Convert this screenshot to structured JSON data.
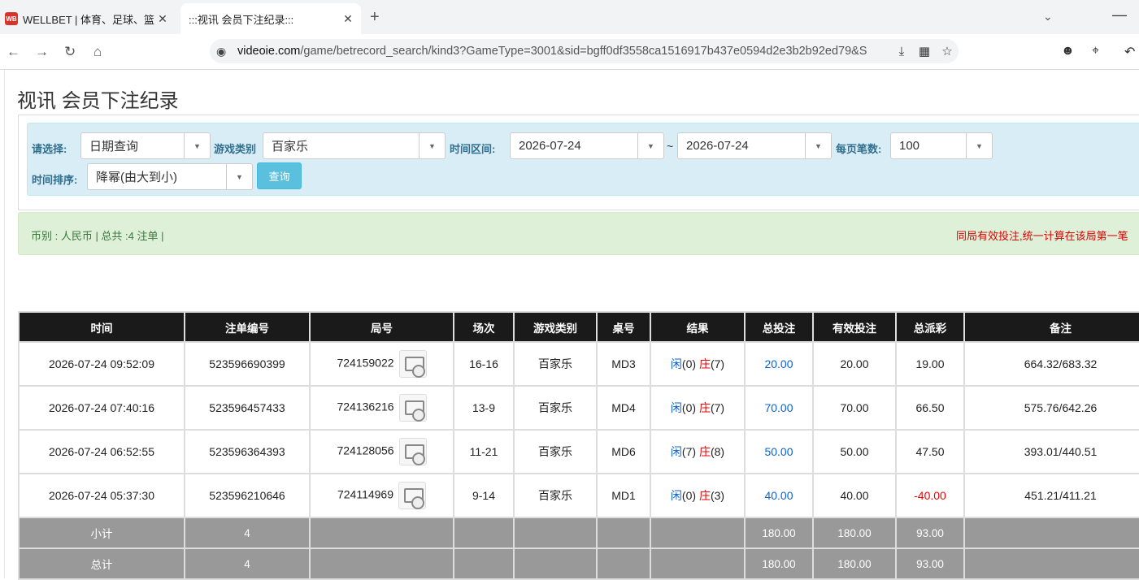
{
  "browser": {
    "tabs": [
      {
        "favicon": "WB",
        "title": "WELLBET | 体育、足球、篮球、",
        "close": "✕"
      },
      {
        "title": ":::视讯 会员下注纪录:::",
        "close": "✕"
      }
    ],
    "new_tab": "+",
    "url_host": "videoie.com",
    "url_path": "/game/betrecord_search/kind3?GameType=3001&sid=bgff0df3558ca1516917b437e0594d2e3b2b92ed79&S"
  },
  "page": {
    "title": "视讯 会员下注纪录",
    "filter": {
      "select_label": "请选择:",
      "select_value": "日期查询",
      "game_label": "游戏类别",
      "game_value": "百家乐",
      "time_label": "时间区间:",
      "date_from": "2026-07-24",
      "tilde": "~",
      "date_to": "2026-07-24",
      "per_page_label": "每页笔数",
      "per_page_value": "100",
      "sort_label": "时间排序:",
      "sort_value": "降幂(由大到小)",
      "query_button": "查询"
    },
    "info": {
      "left": "币别 : 人民币 | 总共 :4 注单 |",
      "right": "同局有效投注,统一计算在该局第一笔"
    },
    "table": {
      "headers": [
        "时间",
        "注单编号",
        "局号",
        "场次",
        "游戏类别",
        "桌号",
        "结果",
        "总投注",
        "有效投注",
        "总派彩",
        "备注"
      ],
      "rows": [
        {
          "time": "2026-07-24 09:52:09",
          "order": "523596690399",
          "round": "724159022",
          "session": "16-16",
          "game": "百家乐",
          "table": "MD3",
          "player": "闲",
          "player_v": "(0)",
          "banker": "庄",
          "banker_v": "(7)",
          "bet": "20.00",
          "valid": "20.00",
          "payout": "19.00",
          "note": "664.32/683.32"
        },
        {
          "time": "2026-07-24 07:40:16",
          "order": "523596457433",
          "round": "724136216",
          "session": "13-9",
          "game": "百家乐",
          "table": "MD4",
          "player": "闲",
          "player_v": "(0)",
          "banker": "庄",
          "banker_v": "(7)",
          "bet": "70.00",
          "valid": "70.00",
          "payout": "66.50",
          "note": "575.76/642.26"
        },
        {
          "time": "2026-07-24 06:52:55",
          "order": "523596364393",
          "round": "724128056",
          "session": "11-21",
          "game": "百家乐",
          "table": "MD6",
          "player": "闲",
          "player_v": "(7)",
          "banker": "庄",
          "banker_v": "(8)",
          "bet": "50.00",
          "valid": "50.00",
          "payout": "47.50",
          "note": "393.01/440.51"
        },
        {
          "time": "2026-07-24 05:37:30",
          "order": "523596210646",
          "round": "724114969",
          "session": "9-14",
          "game": "百家乐",
          "table": "MD1",
          "player": "闲",
          "player_v": "(0)",
          "banker": "庄",
          "banker_v": "(3)",
          "bet": "40.00",
          "valid": "40.00",
          "payout": "-40.00",
          "note": "451.21/411.21"
        }
      ],
      "subtotal": {
        "label": "小计",
        "count": "4",
        "bet": "180.00",
        "valid": "180.00",
        "payout": "93.00"
      },
      "total": {
        "label": "总计",
        "count": "4",
        "bet": "180.00",
        "valid": "180.00",
        "payout": "93.00"
      }
    }
  },
  "colors": {
    "header_bg": "#1a1a1a",
    "filter_bg": "#d9edf7",
    "info_bg": "#dff0d8",
    "query_btn": "#5bc0de",
    "bet_blue": "#0b62d6",
    "loss_red": "#e00"
  }
}
